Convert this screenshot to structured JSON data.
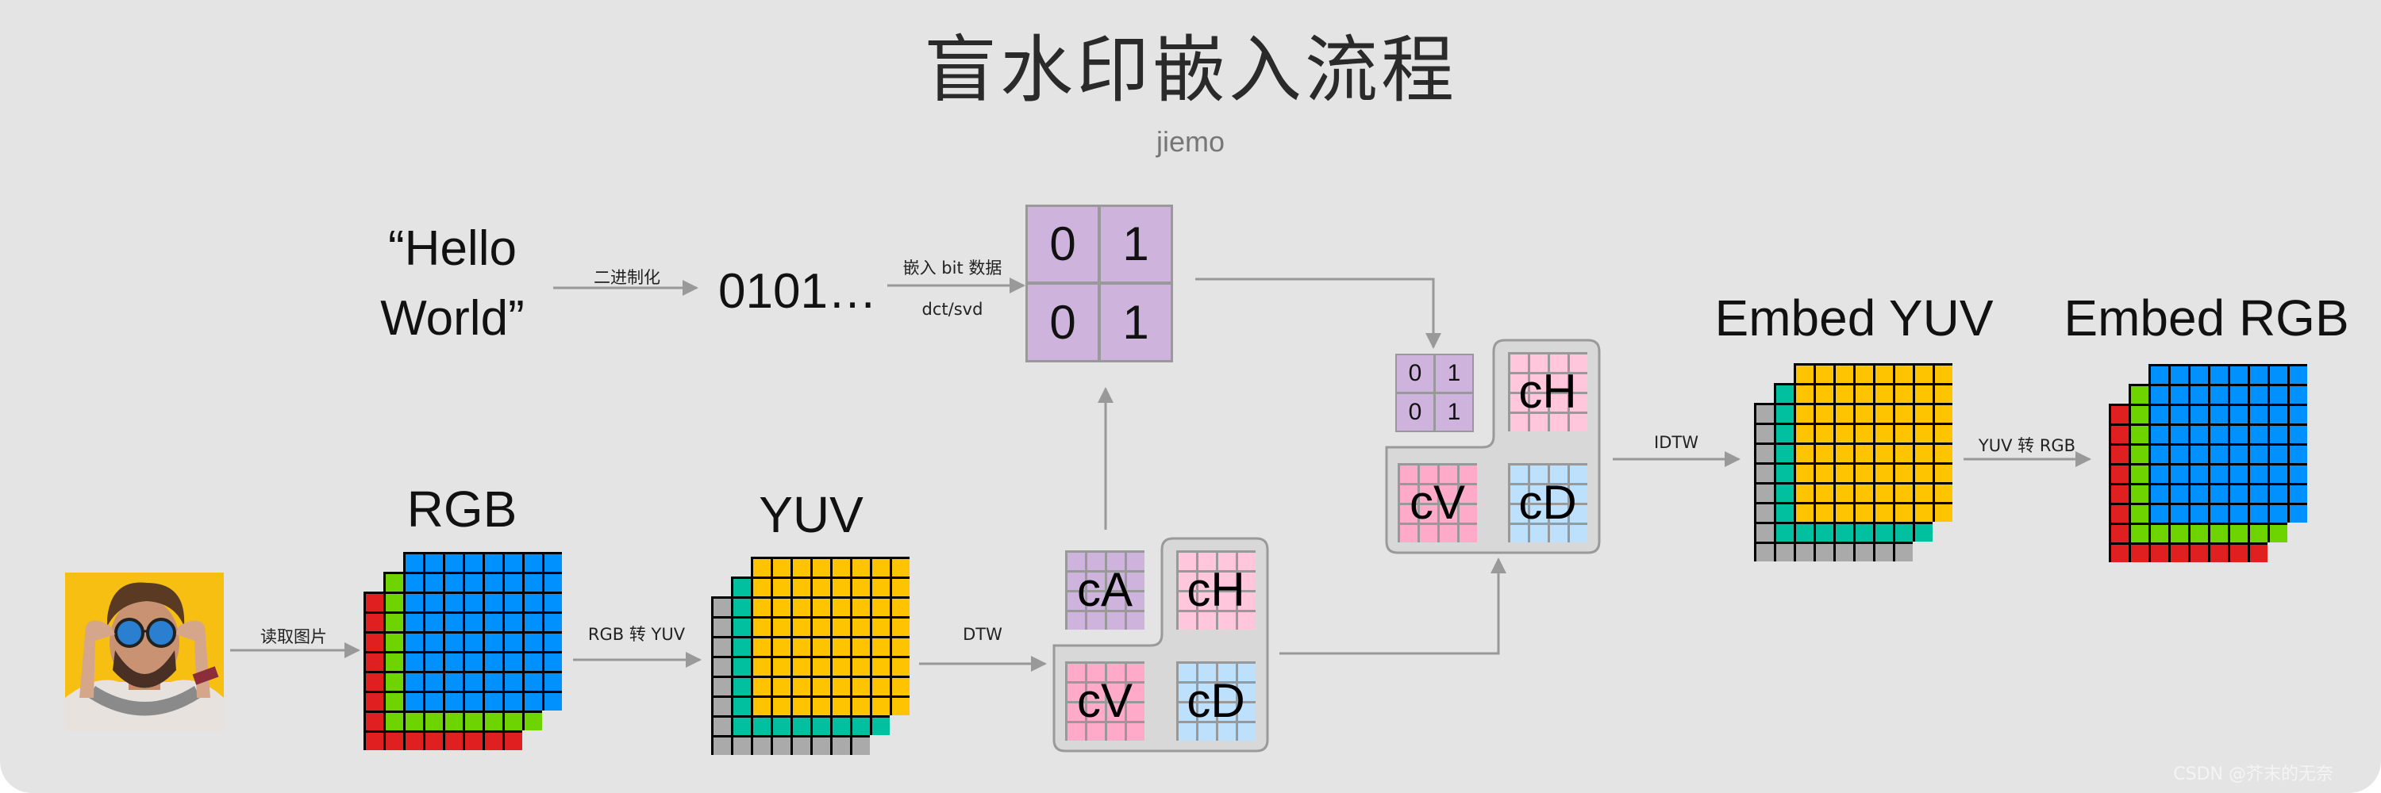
{
  "title": "盲水印嵌入流程",
  "subtitle": "jiemo",
  "watermark": "CSDN @芥末的无奈",
  "message": {
    "line1": "“Hello",
    "line2": "World”"
  },
  "binary": "0101…",
  "arrows": {
    "read_image": "读取图片",
    "rgb_to_yuv": "RGB 转 YUV",
    "dtw": "DTW",
    "binarize": "二进制化",
    "embed_bits": "嵌入 bit 数据",
    "embed_method": "dct/svd",
    "idtw": "IDTW",
    "yuv_to_rgb": "YUV 转 RGB"
  },
  "stages": {
    "rgb": "RGB",
    "yuv": "YUV",
    "embed_yuv": "Embed YUV",
    "embed_rgb": "Embed RGB"
  },
  "bit_matrix": [
    [
      "0",
      "1"
    ],
    [
      "0",
      "1"
    ]
  ],
  "coefficients": {
    "cA": "cA",
    "cH": "cH",
    "cV": "cV",
    "cD": "cD"
  },
  "colors": {
    "background": "#e4e4e4",
    "r": "#e02020",
    "g": "#6dd400",
    "b": "#0091ff",
    "y": "#ffc400",
    "u": "#00c0a0",
    "v": "#aaaaaa",
    "cA": "#ceb4dc",
    "cH": "#ffc6dc",
    "cV": "#ffaac8",
    "cD": "#bde0fd",
    "arrow": "#999999",
    "panel": "#d8d8d8"
  },
  "image": {
    "description": "portrait photo: man with round mirrored sunglasses against yellow wall"
  }
}
